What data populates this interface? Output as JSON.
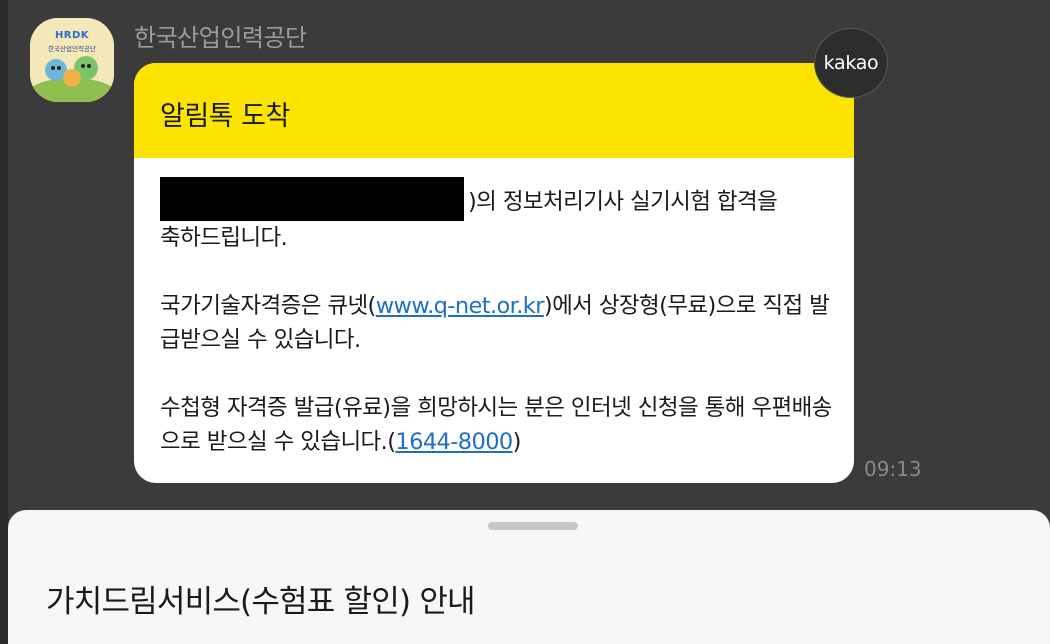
{
  "sender": {
    "name": "한국산업인력공단",
    "avatar_logo": "HRDK",
    "avatar_sub": "한국산업인력공단"
  },
  "message": {
    "header": "알림톡 도착",
    "line1_tail": ")의 정보처리기사 실기시험 합격을",
    "line1_cont": "축하드립니다.",
    "p2_before": "국가기술자격증은 큐넷(",
    "p2_link": "www.q-net.or.kr",
    "p2_after": ")에서 상장형(무료)으로 직접 발급받으실 수 있습니다.",
    "p3_before": "수첩형 자격증 발급(유료)을 희망하시는 분은 인터넷 신청을 통해 우편배송으로 받으실 수 있습니다.(",
    "p3_link": "1644-8000",
    "p3_after": ")",
    "time": "09:13"
  },
  "badge": {
    "label": "kakao"
  },
  "bottom_sheet": {
    "title": "가치드림서비스(수험표 할인) 안내"
  },
  "colors": {
    "header": "#fde400",
    "link": "#1f6fc4",
    "background": "#3b3b3b"
  }
}
